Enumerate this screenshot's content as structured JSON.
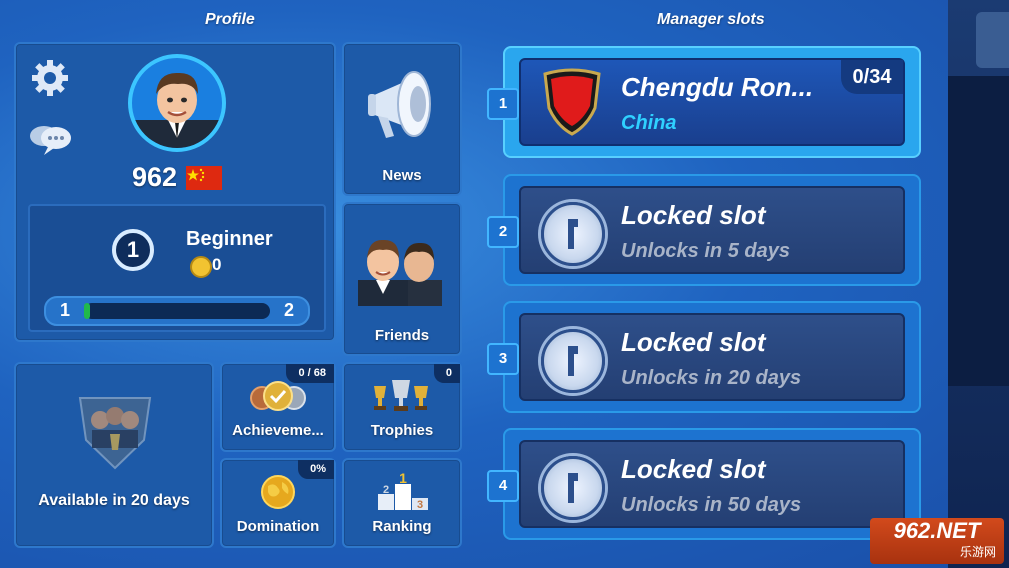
{
  "profile": {
    "section_title": "Profile",
    "points": "962",
    "level": "1",
    "rank_title": "Beginner",
    "coins": "0",
    "progress_start": "1",
    "progress_end": "2",
    "progress_fraction": 0.03
  },
  "tiles": {
    "news": "News",
    "friends": "Friends",
    "trophy_room": "Available in 20 days",
    "achievements": {
      "label": "Achieveme...",
      "badge": "0 / 68"
    },
    "trophies": {
      "label": "Trophies",
      "badge": "0"
    },
    "domination": {
      "label": "Domination",
      "badge": "0%"
    },
    "ranking": {
      "label": "Ranking"
    }
  },
  "slots": {
    "section_title": "Manager slots",
    "items": [
      {
        "num": "1",
        "title": "Chengdu Ron...",
        "subtitle": "China",
        "count": "0/34"
      },
      {
        "num": "2",
        "title": "Locked slot",
        "subtitle": "Unlocks in 5 days"
      },
      {
        "num": "3",
        "title": "Locked slot",
        "subtitle": "Unlocks in 20 days"
      },
      {
        "num": "4",
        "title": "Locked slot",
        "subtitle": "Unlocks in 50 days"
      }
    ]
  },
  "watermark": {
    "brand": "962.NET",
    "sub": "乐游网"
  },
  "icons": {
    "settings": "gear-icon",
    "chat": "chat-bubbles-icon",
    "news": "megaphone-icon",
    "lock": "lock-icon",
    "flag": "china-flag-icon"
  },
  "colors": {
    "background": "#1f63c0",
    "accent": "#2a9ae8",
    "club_crest": "#e01b1b",
    "subtitle_active": "#2fd0ff"
  }
}
